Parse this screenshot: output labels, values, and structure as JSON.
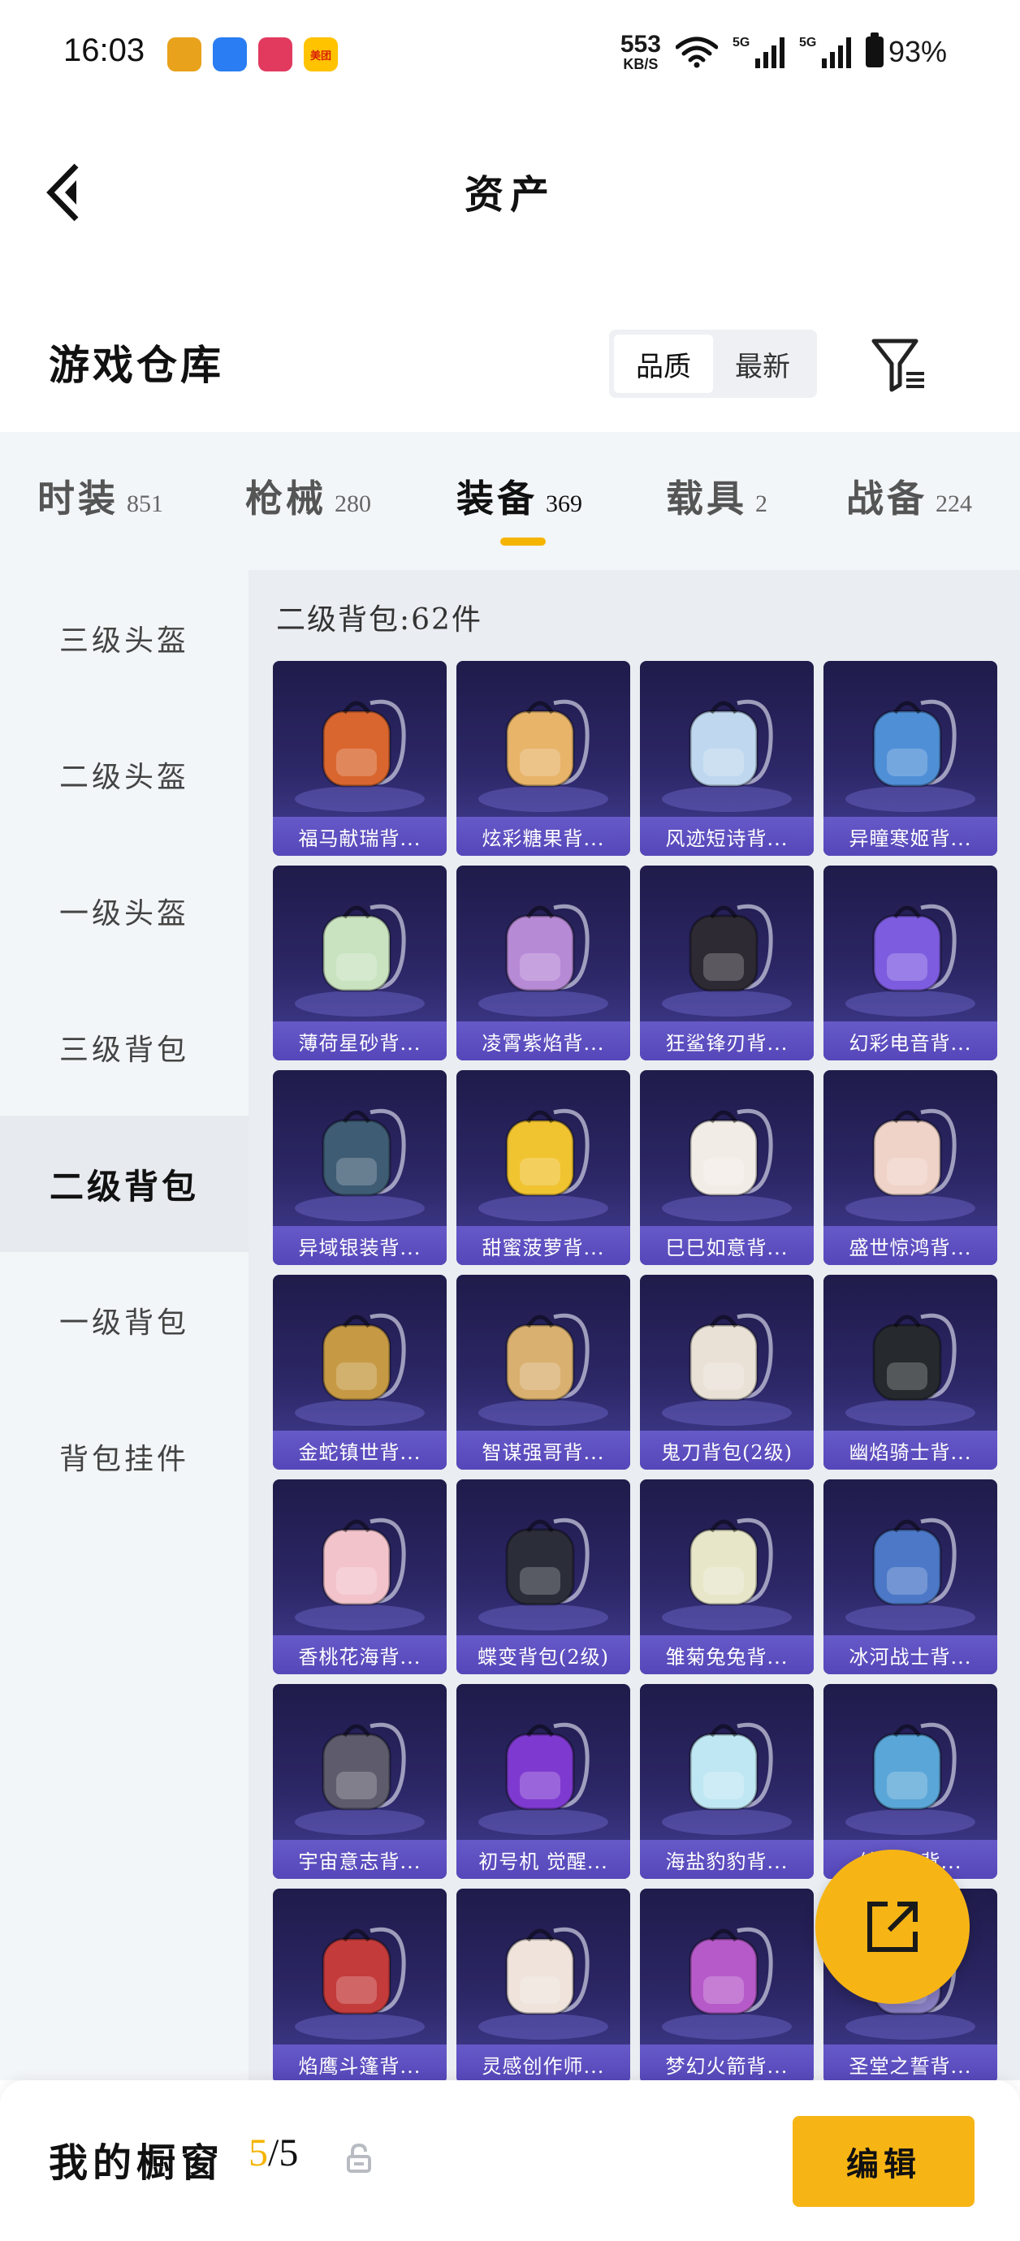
{
  "status": {
    "time": "16:03",
    "apps": [
      {
        "name": "app-icon-1",
        "text": "",
        "color": "#e8a21b"
      },
      {
        "name": "app-icon-2",
        "text": "",
        "color": "#2a7df2"
      },
      {
        "name": "app-icon-3",
        "text": "",
        "color": "#e23a5f"
      },
      {
        "name": "meituan-icon",
        "text": "美团",
        "color": "#ffc300"
      }
    ],
    "net_speed": "553",
    "net_unit": "KB/S",
    "sim1": "5G",
    "sim2": "5G",
    "battery": "93%"
  },
  "header": {
    "title": "资产"
  },
  "section": {
    "title": "游戏仓库",
    "sort_options": [
      "品质",
      "最新"
    ],
    "sort_active": "品质"
  },
  "tabs": [
    {
      "label": "时装",
      "count": "851"
    },
    {
      "label": "枪械",
      "count": "280"
    },
    {
      "label": "装备",
      "count": "369"
    },
    {
      "label": "载具",
      "count": "2"
    },
    {
      "label": "战备",
      "count": "224"
    }
  ],
  "active_tab": "装备",
  "sidebar": {
    "items": [
      "三级头盔",
      "二级头盔",
      "一级头盔",
      "三级背包",
      "二级背包",
      "一级背包",
      "背包挂件"
    ],
    "active": "二级背包"
  },
  "content": {
    "title": "二级背包:62件",
    "items": [
      {
        "name": "福马献瑞背...",
        "hue": "#d9662f"
      },
      {
        "name": "炫彩糖果背...",
        "hue": "#e7b46a"
      },
      {
        "name": "风迹短诗背...",
        "hue": "#bfd8ef"
      },
      {
        "name": "异瞳寒姬背...",
        "hue": "#4f8fd6"
      },
      {
        "name": "薄荷星砂背...",
        "hue": "#c9e3c0"
      },
      {
        "name": "凌霄紫焰背...",
        "hue": "#b78ad6"
      },
      {
        "name": "狂鲨锋刃背...",
        "hue": "#2d2a33"
      },
      {
        "name": "幻彩电音背...",
        "hue": "#7d5ce0"
      },
      {
        "name": "异域银装背...",
        "hue": "#3e5c74"
      },
      {
        "name": "甜蜜菠萝背...",
        "hue": "#f0c330"
      },
      {
        "name": "巳巳如意背...",
        "hue": "#f2ece6"
      },
      {
        "name": "盛世惊鸿背...",
        "hue": "#efd2c8"
      },
      {
        "name": "金蛇镇世背...",
        "hue": "#c69a45"
      },
      {
        "name": "智谋强哥背...",
        "hue": "#d9b070"
      },
      {
        "name": "鬼刀背包(2级)",
        "hue": "#e9e1d6"
      },
      {
        "name": "幽焰骑士背...",
        "hue": "#262a2e"
      },
      {
        "name": "香桃花海背...",
        "hue": "#f3c3cc"
      },
      {
        "name": "蝶变背包(2级)",
        "hue": "#2b2d39"
      },
      {
        "name": "雏菊兔兔背...",
        "hue": "#e7e6c9"
      },
      {
        "name": "冰河战士背...",
        "hue": "#4c78c7"
      },
      {
        "name": "宇宙意志背...",
        "hue": "#5e5c6c"
      },
      {
        "name": "初号机 觉醒...",
        "hue": "#7e3ad0"
      },
      {
        "name": "海盐豹豹背...",
        "hue": "#bfe7f3"
      },
      {
        "name": "纯真...背...",
        "hue": "#5aa6d8"
      },
      {
        "name": "焰鹰斗篷背...",
        "hue": "#c43b3b"
      },
      {
        "name": "灵感创作师...",
        "hue": "#efe3dc"
      },
      {
        "name": "梦幻火箭背...",
        "hue": "#b65ac9"
      },
      {
        "name": "圣堂之誓背...",
        "hue": "#8a80c6"
      }
    ]
  },
  "bottom": {
    "label": "我的橱窗",
    "count_current": "5",
    "count_total": "/5",
    "edit_label": "编辑"
  },
  "colors": {
    "accent": "#f7b515",
    "card_label": "#5a4bbf",
    "card_bg": "#2c2766"
  }
}
